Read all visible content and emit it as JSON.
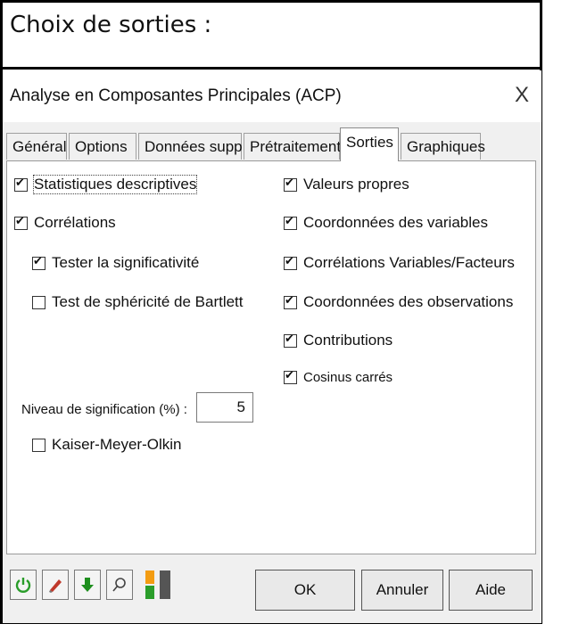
{
  "heading": "Choix de sorties :",
  "dialog": {
    "title": "Analyse en Composantes Principales (ACP)",
    "close_glyph": "X"
  },
  "tabs": [
    {
      "label": "Général",
      "active": false
    },
    {
      "label": "Options",
      "active": false
    },
    {
      "label": "Données supp.",
      "active": false
    },
    {
      "label": "Prétraitement",
      "active": false
    },
    {
      "label": "Sorties",
      "active": true
    },
    {
      "label": "Graphiques",
      "active": false
    }
  ],
  "left_options": {
    "stats_desc": {
      "label": "Statistiques descriptives",
      "checked": true
    },
    "correlations": {
      "label": "Corrélations",
      "checked": true
    },
    "tester_signif": {
      "label": "Tester la significativité",
      "checked": true
    },
    "bartlett": {
      "label": "Test de sphéricité de Bartlett",
      "checked": false
    },
    "significance_label": "Niveau de signification (%) :",
    "significance_value": "5",
    "kmo": {
      "label": "Kaiser-Meyer-Olkin",
      "checked": false
    }
  },
  "right_options": {
    "valeurs_propres": {
      "label": "Valeurs propres",
      "checked": true
    },
    "coord_variables": {
      "label": "Coordonnées des variables",
      "checked": true
    },
    "corr_var_fact": {
      "label": "Corrélations Variables/Facteurs",
      "checked": true
    },
    "coord_obs": {
      "label": "Coordonnées des observations",
      "checked": true
    },
    "contributions": {
      "label": "Contributions",
      "checked": true
    },
    "cosinus": {
      "label": "Cosinus carrés",
      "checked": true
    }
  },
  "buttons": {
    "ok": "OK",
    "cancel": "Annuler",
    "help": "Aide"
  },
  "icons": [
    "reset-icon",
    "eraser-icon",
    "down-arrow-icon",
    "pin-icon",
    "layout-icon"
  ],
  "colors": {
    "reset": "#2a9d2a",
    "eraser": "#c0392b",
    "down_arrow": "#1e8f1e",
    "layout_orange": "#f39c12",
    "layout_gray": "#555555"
  }
}
